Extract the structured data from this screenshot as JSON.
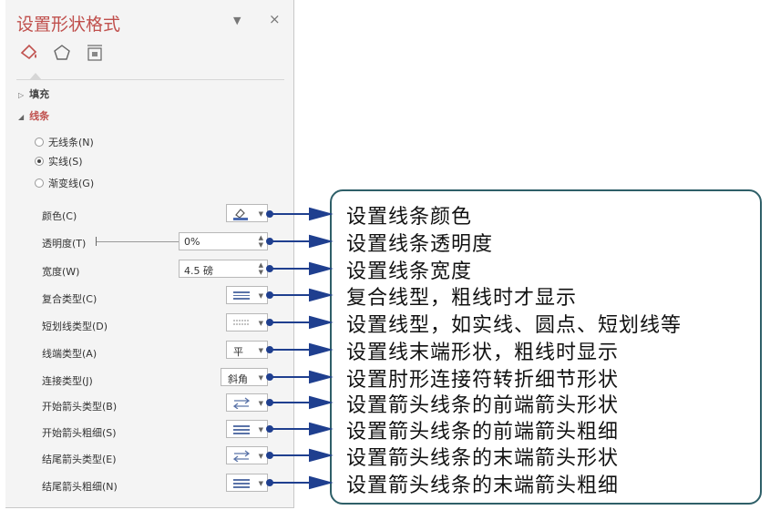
{
  "panel": {
    "title": "设置形状格式",
    "pin_icon": "chevron-down-icon",
    "close_label": "×",
    "tab_icons": [
      "paint-bucket-icon",
      "pentagon-icon",
      "size-position-icon"
    ],
    "fill_section": "填充",
    "line_section": "线条",
    "radios": [
      {
        "label": "无线条(N)",
        "selected": false
      },
      {
        "label": "实线(S)",
        "selected": true
      },
      {
        "label": "渐变线(G)",
        "selected": false
      }
    ],
    "rows": {
      "color": "颜色(C)",
      "transparency": "透明度(T)",
      "width": "宽度(W)",
      "compound": "复合类型(C)",
      "dash": "短划线类型(D)",
      "cap": "线端类型(A)",
      "join": "连接类型(J)",
      "begin_arrow_type": "开始箭头类型(B)",
      "begin_arrow_size": "开始箭头粗细(S)",
      "end_arrow_type": "结尾箭头类型(E)",
      "end_arrow_size": "结尾箭头粗细(N)"
    },
    "values": {
      "transparency": "0%",
      "width": "4.5 磅",
      "cap": "平",
      "join": "斜角"
    }
  },
  "annotations": [
    "设置线条颜色",
    "设置线条透明度",
    "设置线条宽度",
    "复合线型，粗线时才显示",
    "设置线型，如实线、圆点、短划线等",
    "设置线末端形状，粗线时显示",
    "设置肘形连接符转折细节形状",
    "设置箭头线条的前端箭头形状",
    "设置箭头线条的前端箭头粗细",
    "设置箭头线条的末端箭头形状",
    "设置箭头线条的末端箭头粗细"
  ],
  "colors": {
    "accent": "#c0504d",
    "callout_border": "#2e5f68",
    "connector": "#1f3f8f"
  }
}
